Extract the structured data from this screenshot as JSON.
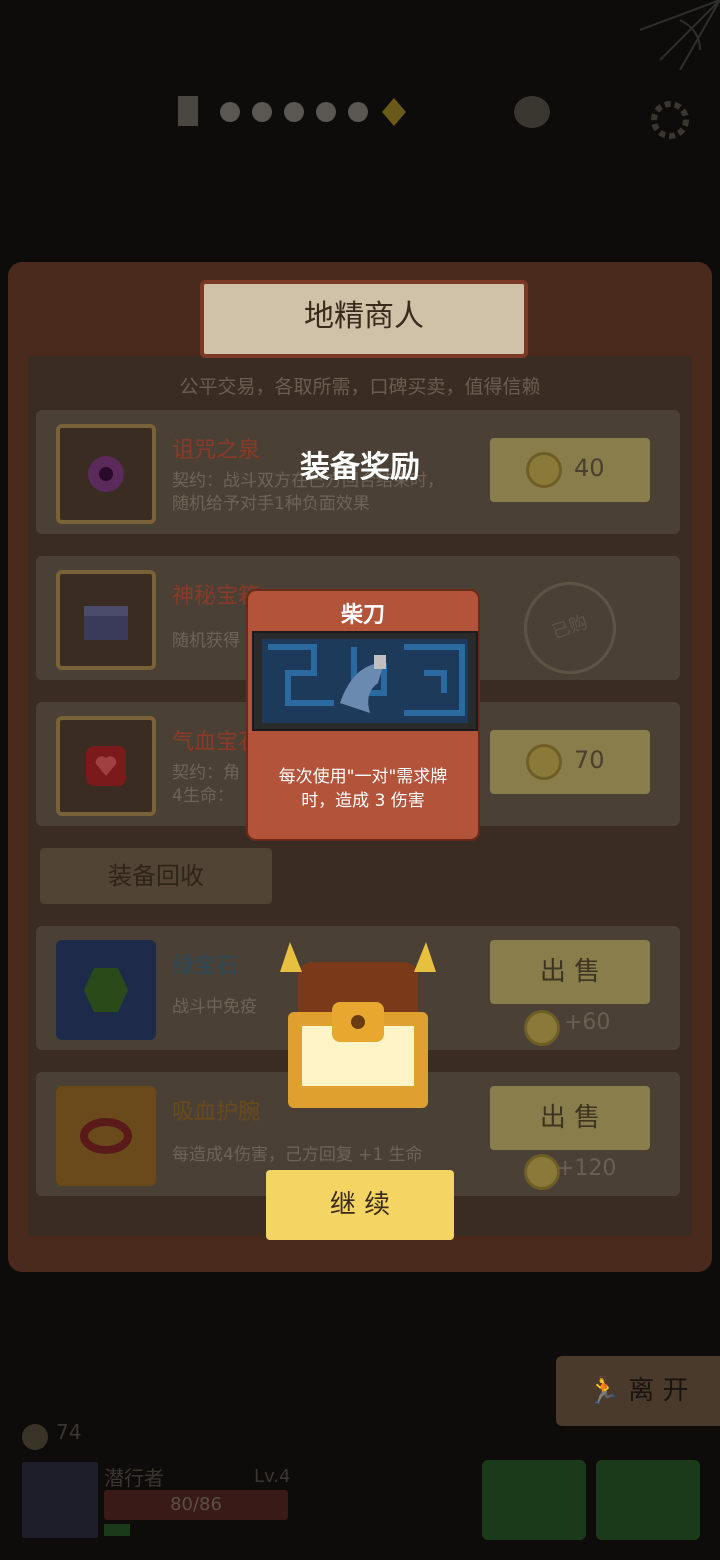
{
  "merchant": {
    "title": "地精商人",
    "subtitle": "公平交易，各取所需，口碑买卖，值得信赖",
    "items": [
      {
        "name": "诅咒之泉",
        "desc_line1": "契约：战斗双方在己方回合结束时，",
        "desc_line2": "随机给予对手1种负面效果",
        "price": "40",
        "icon": "curse-spring-icon"
      },
      {
        "name": "神秘宝箱",
        "desc_line1": "随机获得",
        "price": "",
        "stamp": "已购",
        "icon": "mystery-chest-icon"
      },
      {
        "name": "气血宝石",
        "desc_line1": "契约：角",
        "desc_line2": "4生命：",
        "price": "70",
        "icon": "vitality-gem-icon"
      }
    ]
  },
  "recycle": {
    "title": "装备回收",
    "items": [
      {
        "name": "绿宝石",
        "desc": "战斗中免疫",
        "sell_label": "出 售",
        "sell_price": "+60"
      },
      {
        "name": "吸血护腕",
        "desc": "每造成4伤害，己方回复 +1 生命",
        "sell_label": "出 售",
        "sell_price": "+120"
      }
    ]
  },
  "reward": {
    "title": "装备奖励",
    "card_name": "柴刀",
    "card_desc_line1": "每次使用\"一对\"需求牌",
    "card_desc_line2": "时，造成 3 伤害",
    "continue_label": "继 续"
  },
  "bottom": {
    "leave_label": "离 开",
    "gold": "74",
    "player_name": "潜行者",
    "level": "Lv.4",
    "hp": "80/86"
  }
}
